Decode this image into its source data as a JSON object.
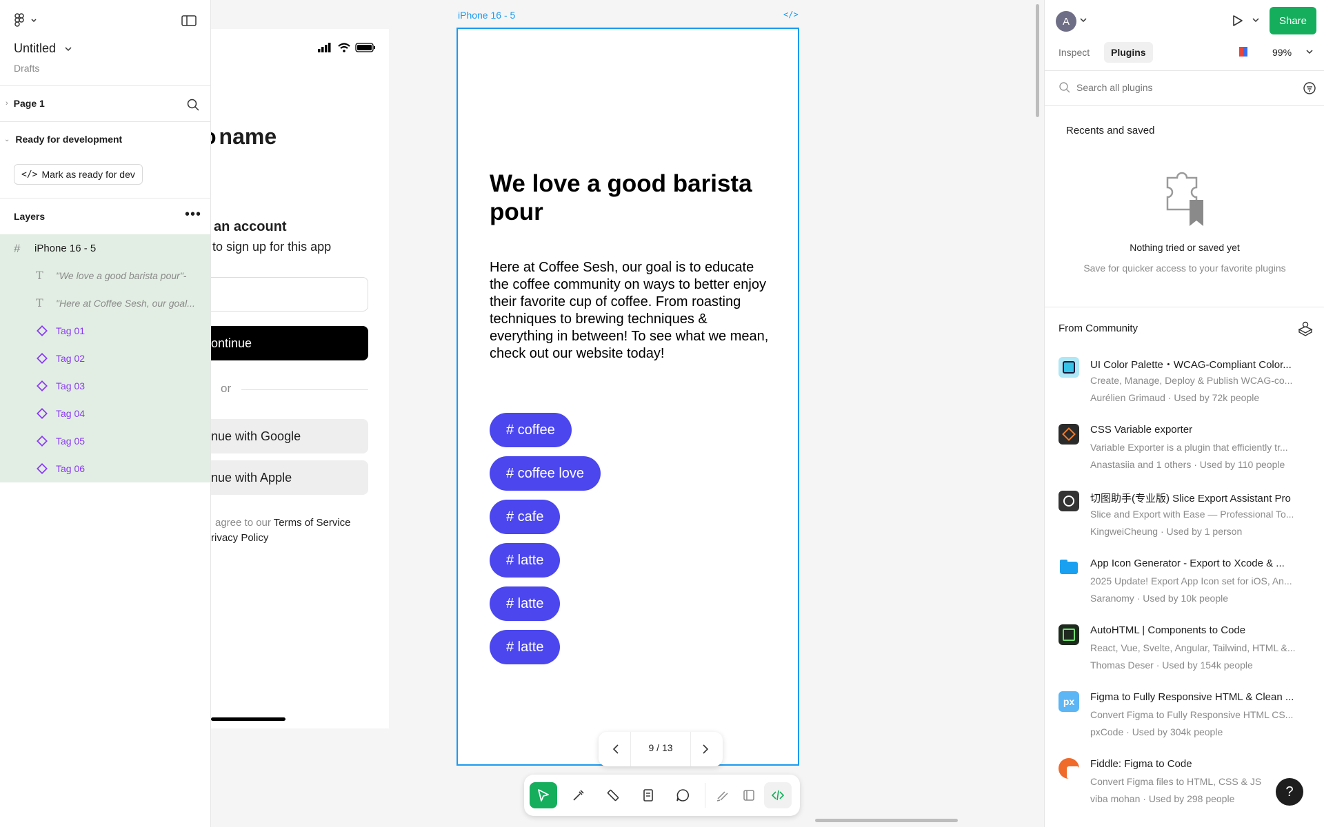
{
  "app": {
    "file_name": "Untitled",
    "file_location": "Drafts"
  },
  "left_panel": {
    "page": "Page 1",
    "section": "Ready for development",
    "mark_ready_label": "Mark as ready for dev",
    "layers_title": "Layers",
    "layers": [
      {
        "name": "iPhone 16 - 5",
        "type": "frame"
      },
      {
        "name": "\"We love a good barista pour\"-",
        "type": "text"
      },
      {
        "name": "\"Here at Coffee Sesh, our goal...",
        "type": "text"
      },
      {
        "name": "Tag 01",
        "type": "component"
      },
      {
        "name": "Tag 02",
        "type": "component"
      },
      {
        "name": "Tag 03",
        "type": "component"
      },
      {
        "name": "Tag 04",
        "type": "component"
      },
      {
        "name": "Tag 05",
        "type": "component"
      },
      {
        "name": "Tag 06",
        "type": "component"
      }
    ]
  },
  "canvas": {
    "left_frame": {
      "title_fragment": "name",
      "account_heading": "an account",
      "signup_text": "to sign up for this app",
      "continue": "ontinue",
      "or": "or",
      "google": "nue with Google",
      "apple": "nue with Apple",
      "terms_prefix": "agree to our ",
      "terms_link": "Terms of Service",
      "privacy_link": "rivacy Policy"
    },
    "main_frame": {
      "label": "iPhone 16 - 5",
      "code_icon": "</>",
      "heading": "We love a good barista pour",
      "body": "Here at Coffee Sesh, our goal is to educate the coffee community on ways to better enjoy their favorite cup of coffee. From roasting techniques to brewing techniques & everything in between! To see what we mean, check out our website today!",
      "tags": [
        "# coffee",
        "# coffee love",
        "# cafe",
        "# latte",
        "# latte",
        "# latte"
      ],
      "tag_color": "#4b46ee"
    },
    "pager": {
      "text": "9 / 13"
    }
  },
  "right_panel": {
    "avatar": "A",
    "share": "Share",
    "tabs": [
      "Inspect",
      "Plugins"
    ],
    "active_tab": "Plugins",
    "zoom": "99%",
    "search_placeholder": "Search all plugins",
    "recents_title": "Recents and saved",
    "empty_title": "Nothing tried or saved yet",
    "empty_sub": "Save for quicker access to your favorite plugins",
    "community_title": "From Community",
    "plugins": [
      {
        "title": "UI Color Palette・WCAG-Compliant Color...",
        "desc": "Create, Manage, Deploy & Publish WCAG-co...",
        "meta": "Aurélien Grimaud · Used by 72k people",
        "icon_color": "#35c3e8"
      },
      {
        "title": "CSS Variable exporter",
        "desc": "Variable Exporter is a plugin that efficiently tr...",
        "meta": "Anastasiia and 1 others · Used by 110 people",
        "icon_color": "#2a2a2a"
      },
      {
        "title": "切图助手(专业版) Slice Export Assistant Pro",
        "desc": "Slice and Export with Ease — Professional To...",
        "meta": "KingweiCheung · Used by 1 person",
        "icon_color": "#333333"
      },
      {
        "title": "App Icon Generator - Export to Xcode & ...",
        "desc": "2025 Update! Export App Icon set for iOS, An...",
        "meta": "Saranomy · Used by 10k people",
        "icon_color": "#1aa0f0"
      },
      {
        "title": "AutoHTML | Components to Code",
        "desc": "React, Vue, Svelte, Angular, Tailwind, HTML &...",
        "meta": "Thomas Deser · Used by 154k people",
        "icon_color": "#1f2a1f"
      },
      {
        "title": "Figma to Fully Responsive HTML & Clean ...",
        "desc": "Convert Figma to Fully Responsive HTML CS...",
        "meta": "pxCode · Used by 304k people",
        "icon_color": "#5cb5f5"
      },
      {
        "title": "Fiddle: Figma to Code",
        "desc": "Convert Figma files to HTML, CSS & JS",
        "meta": "viba mohan · Used by 298 people",
        "icon_color": "#f06a2a"
      }
    ],
    "help": "?"
  },
  "colors": {
    "accent_green": "#14ae5c",
    "selection_blue": "#1a9bf0",
    "layer_highlight": "#e2eee3"
  }
}
